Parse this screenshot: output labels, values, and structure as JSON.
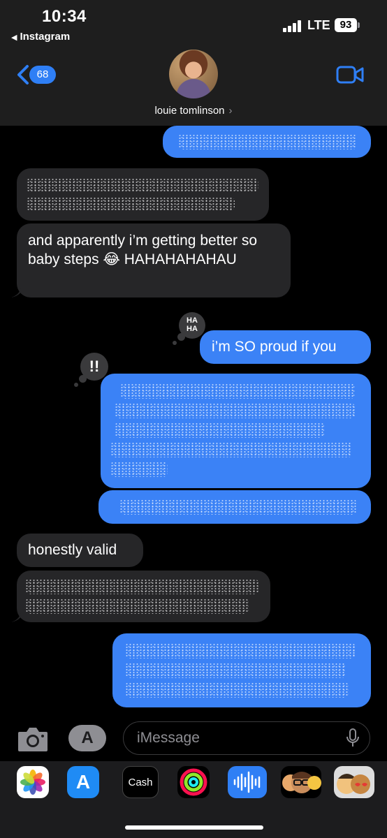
{
  "status_bar": {
    "time": "10:34",
    "back_app": "Instagram",
    "network": "LTE",
    "battery": "93"
  },
  "header": {
    "unread_count": "68",
    "contact_name": "louie tomlinson",
    "back_icon": "chevron-left-icon",
    "video_icon": "video-camera-icon"
  },
  "messages": [
    {
      "from": "me",
      "text": ""
    },
    {
      "from": "them",
      "text": ""
    },
    {
      "from": "them",
      "text": "and apparently i’m getting better so baby steps 😂 HAHAHAHAHAU"
    },
    {
      "from": "me",
      "text": "i’m SO proud if you",
      "tapback": "HA HA"
    },
    {
      "from": "me",
      "text": "",
      "tapback": "!!"
    },
    {
      "from": "me",
      "text": ""
    },
    {
      "from": "them",
      "text": "honestly valid"
    },
    {
      "from": "them",
      "text": ""
    },
    {
      "from": "me",
      "text": ""
    }
  ],
  "input_bar": {
    "placeholder": "iMessage",
    "camera_icon": "camera-icon",
    "apps_icon": "app-store-icon",
    "mic_icon": "microphone-icon"
  },
  "app_drawer": {
    "apps": [
      "Photos",
      "App Store",
      "Cash",
      "Activity",
      "Voice",
      "Memoji",
      "Animoji"
    ],
    "cash_label": "Cash"
  },
  "colors": {
    "sent_bubble": "#3b82f6",
    "received_bubble": "#262628",
    "badge": "#2f7ff5",
    "header_bg": "#1e1e1e"
  }
}
